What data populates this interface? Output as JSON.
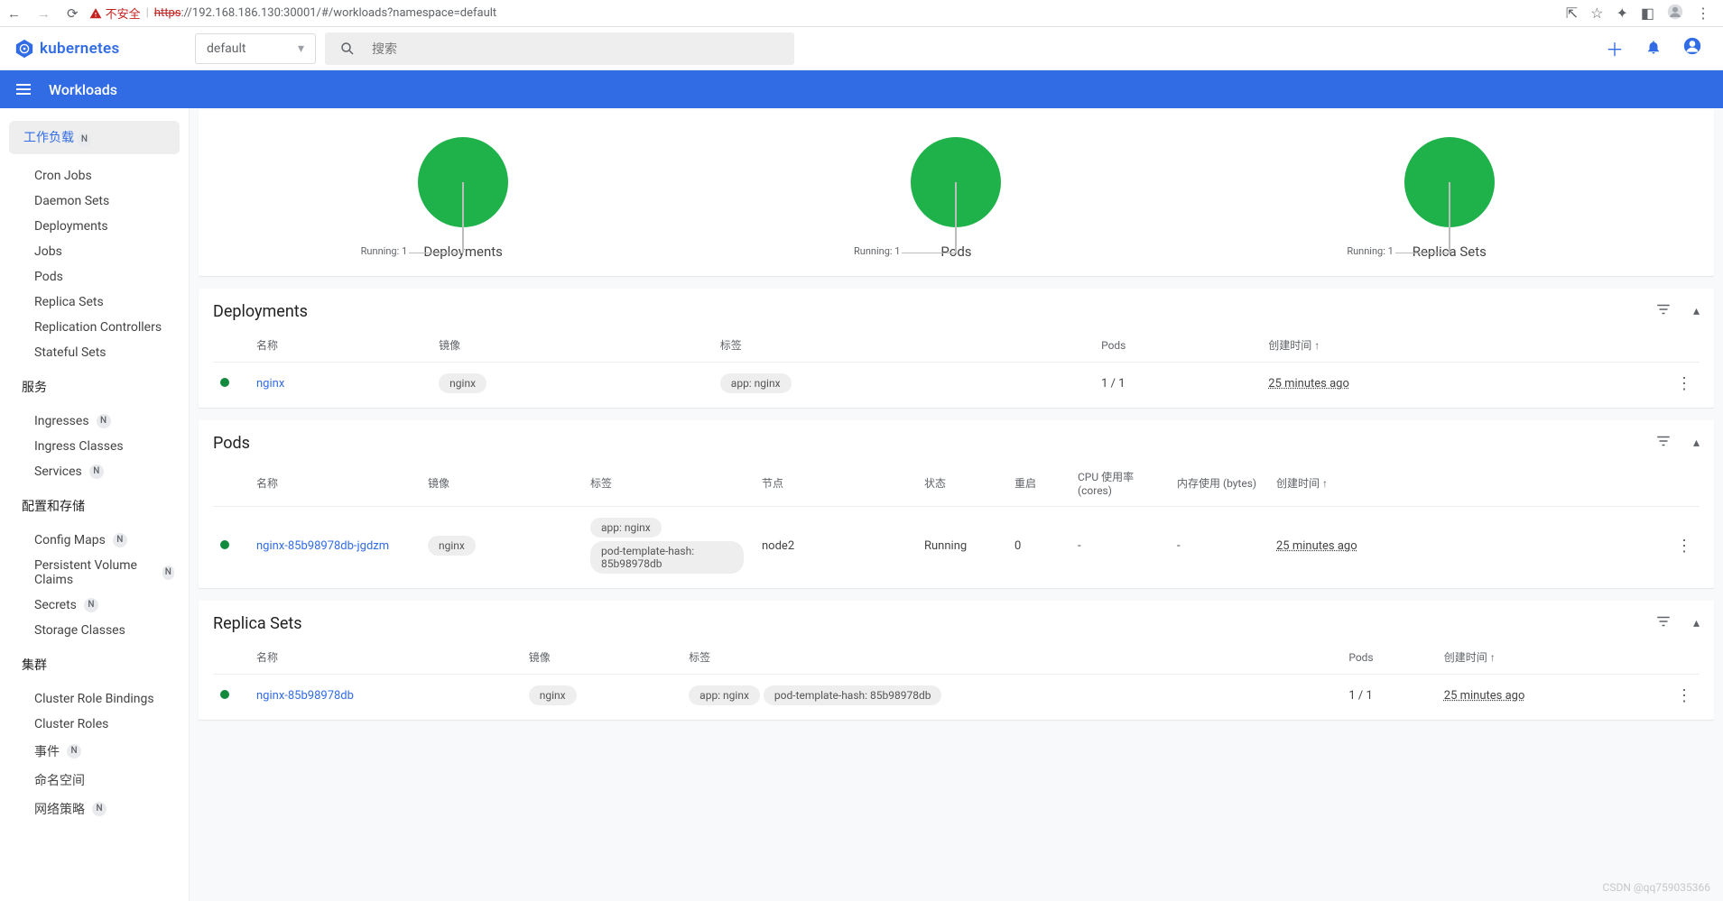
{
  "browser": {
    "insecure_label": "不安全",
    "url_https": "https",
    "url_rest": "://192.168.186.130:30001/#/workloads?namespace=default"
  },
  "app": {
    "brand_name": "kubernetes",
    "namespace_selected": "default",
    "search_placeholder": "搜索",
    "section_title": "Workloads"
  },
  "sidebar": {
    "active_label": "工作负载",
    "group1": [
      "Cron Jobs",
      "Daemon Sets",
      "Deployments",
      "Jobs",
      "Pods",
      "Replica Sets",
      "Replication Controllers",
      "Stateful Sets"
    ],
    "title_services": "服务",
    "group2": [
      {
        "label": "Ingresses",
        "badge": "N"
      },
      {
        "label": "Ingress Classes",
        "badge": null
      },
      {
        "label": "Services",
        "badge": "N"
      }
    ],
    "title_config": "配置和存储",
    "group3": [
      {
        "label": "Config Maps",
        "badge": "N"
      },
      {
        "label": "Persistent Volume Claims",
        "badge": "N"
      },
      {
        "label": "Secrets",
        "badge": "N"
      },
      {
        "label": "Storage Classes",
        "badge": null
      }
    ],
    "title_cluster": "集群",
    "group4": [
      {
        "label": "Cluster Role Bindings",
        "badge": null
      },
      {
        "label": "Cluster Roles",
        "badge": null
      },
      {
        "label": "事件",
        "badge": "N"
      },
      {
        "label": "命名空间",
        "badge": null
      },
      {
        "label": "网络策略",
        "badge": "N"
      }
    ]
  },
  "chart_data": [
    {
      "type": "pie",
      "title": "Deployments",
      "series": [
        {
          "name": "Running",
          "value": 1
        }
      ],
      "label": "Running: 1"
    },
    {
      "type": "pie",
      "title": "Pods",
      "series": [
        {
          "name": "Running",
          "value": 1
        }
      ],
      "label": "Running: 1"
    },
    {
      "type": "pie",
      "title": "Replica Sets",
      "series": [
        {
          "name": "Running",
          "value": 1
        }
      ],
      "label": "Running: 1"
    }
  ],
  "tables": {
    "deployments": {
      "title": "Deployments",
      "headers": {
        "name": "名称",
        "images": "镜像",
        "labels": "标签",
        "pods": "Pods",
        "created": "创建时间"
      },
      "rows": [
        {
          "name": "nginx",
          "images": [
            "nginx"
          ],
          "labels": [
            "app: nginx"
          ],
          "pods": "1 / 1",
          "created": "25 minutes ago"
        }
      ]
    },
    "pods": {
      "title": "Pods",
      "headers": {
        "name": "名称",
        "images": "镜像",
        "labels": "标签",
        "node": "节点",
        "status": "状态",
        "restarts": "重启",
        "cpu": "CPU 使用率 (cores)",
        "mem": "内存使用 (bytes)",
        "created": "创建时间"
      },
      "rows": [
        {
          "name": "nginx-85b98978db-jgdzm",
          "images": [
            "nginx"
          ],
          "labels": [
            "app: nginx",
            "pod-template-hash: 85b98978db"
          ],
          "node": "node2",
          "status": "Running",
          "restarts": "0",
          "cpu": "-",
          "mem": "-",
          "created": "25 minutes ago"
        }
      ]
    },
    "replicasets": {
      "title": "Replica Sets",
      "headers": {
        "name": "名称",
        "images": "镜像",
        "labels": "标签",
        "pods": "Pods",
        "created": "创建时间"
      },
      "rows": [
        {
          "name": "nginx-85b98978db",
          "images": [
            "nginx"
          ],
          "labels": [
            "app: nginx",
            "pod-template-hash: 85b98978db"
          ],
          "pods": "1 / 1",
          "created": "25 minutes ago"
        }
      ]
    }
  },
  "watermark": "CSDN @qq759035366"
}
